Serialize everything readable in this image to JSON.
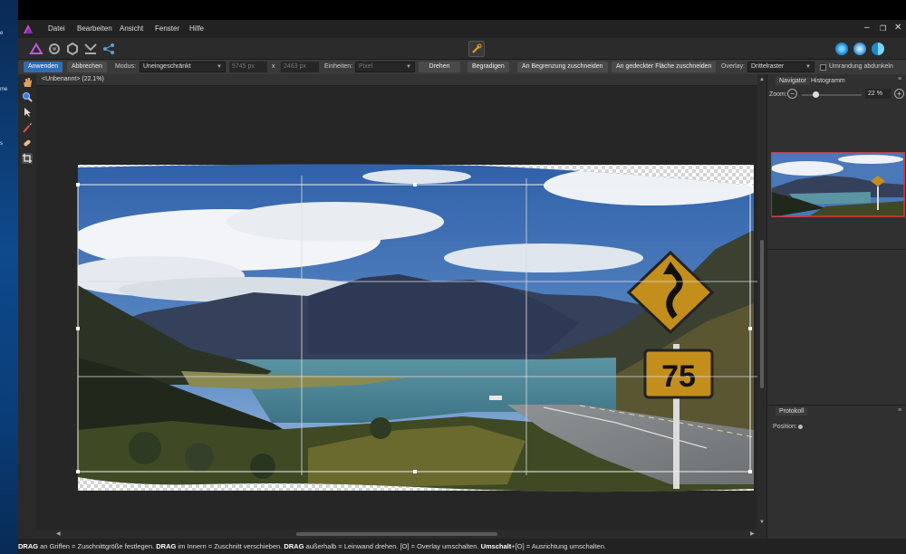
{
  "desktop": {
    "icon_labels": [
      "e",
      "me",
      "s"
    ]
  },
  "menu": [
    "Datei",
    "Bearbeiten",
    "Ansicht",
    "Fenster",
    "Hilfe"
  ],
  "window_controls": {
    "minimize": "–",
    "maximize": "❐",
    "close": "✕"
  },
  "context_toolbar": {
    "apply": "Anwenden",
    "cancel": "Abbrechen",
    "mode_label": "Modus:",
    "mode_value": "Uneingeschränkt",
    "width_value": "5745 px",
    "times": "x",
    "height_value": "2463 px",
    "units_label": "Einheiten:",
    "units_value": "Pixel",
    "rotate": "Drehen",
    "straighten": "Begradigen",
    "crop_to_bounds": "An Begrenzung zuschneiden",
    "crop_to_covered": "An gedeckter Fläche zuschneiden",
    "overlay_label": "Overlay:",
    "overlay_value": "Drittelraster",
    "darken_checkbox": "Umrandung abdunkeln"
  },
  "document_tab": "<Unbenannt> (22.1%)",
  "panels": {
    "navigator_tab": "Navigator",
    "histogram_tab": "Histogramm",
    "zoom_label": "Zoom:",
    "zoom_value": "22 %",
    "zoom_fraction": 0.22,
    "history_tab": "Protokoll",
    "position_label": "Position:"
  },
  "sign": {
    "speed": "75"
  },
  "status": {
    "segments": [
      {
        "b": "DRAG",
        "t": " an Griffen = Zuschnittgröße festlegen. "
      },
      {
        "b": "DRAG",
        "t": " im Innern = Zuschnitt verschieben. "
      },
      {
        "b": "DRAG",
        "t": " außerhalb = Leinwand drehen. [O] = Overlay umschalten. "
      },
      {
        "b": "Umschalt",
        "t": "+[O] = Ausrichtung umschalten."
      }
    ]
  },
  "colors": {
    "accent": "#2f6db3",
    "sky": "#4a78b8",
    "lake": "#5b95a3",
    "sign": "#c48e1c"
  }
}
